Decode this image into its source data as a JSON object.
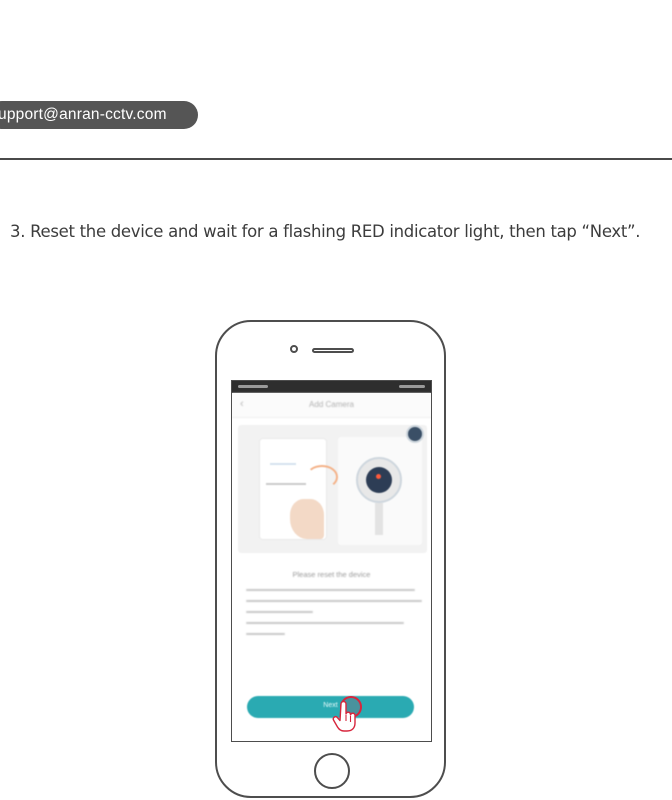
{
  "header": {
    "email": "upport@anran-cctv.com"
  },
  "instruction": {
    "text": "3.  Reset the device and wait for a flashing RED indicator light, then tap “Next”."
  },
  "phone_screen": {
    "nav_back": "‹",
    "title": "Add Camera",
    "sub_heading": "Please reset the device",
    "next_label": "Next",
    "accent_color": "#2aaab2",
    "tap_color": "#d7263d"
  }
}
